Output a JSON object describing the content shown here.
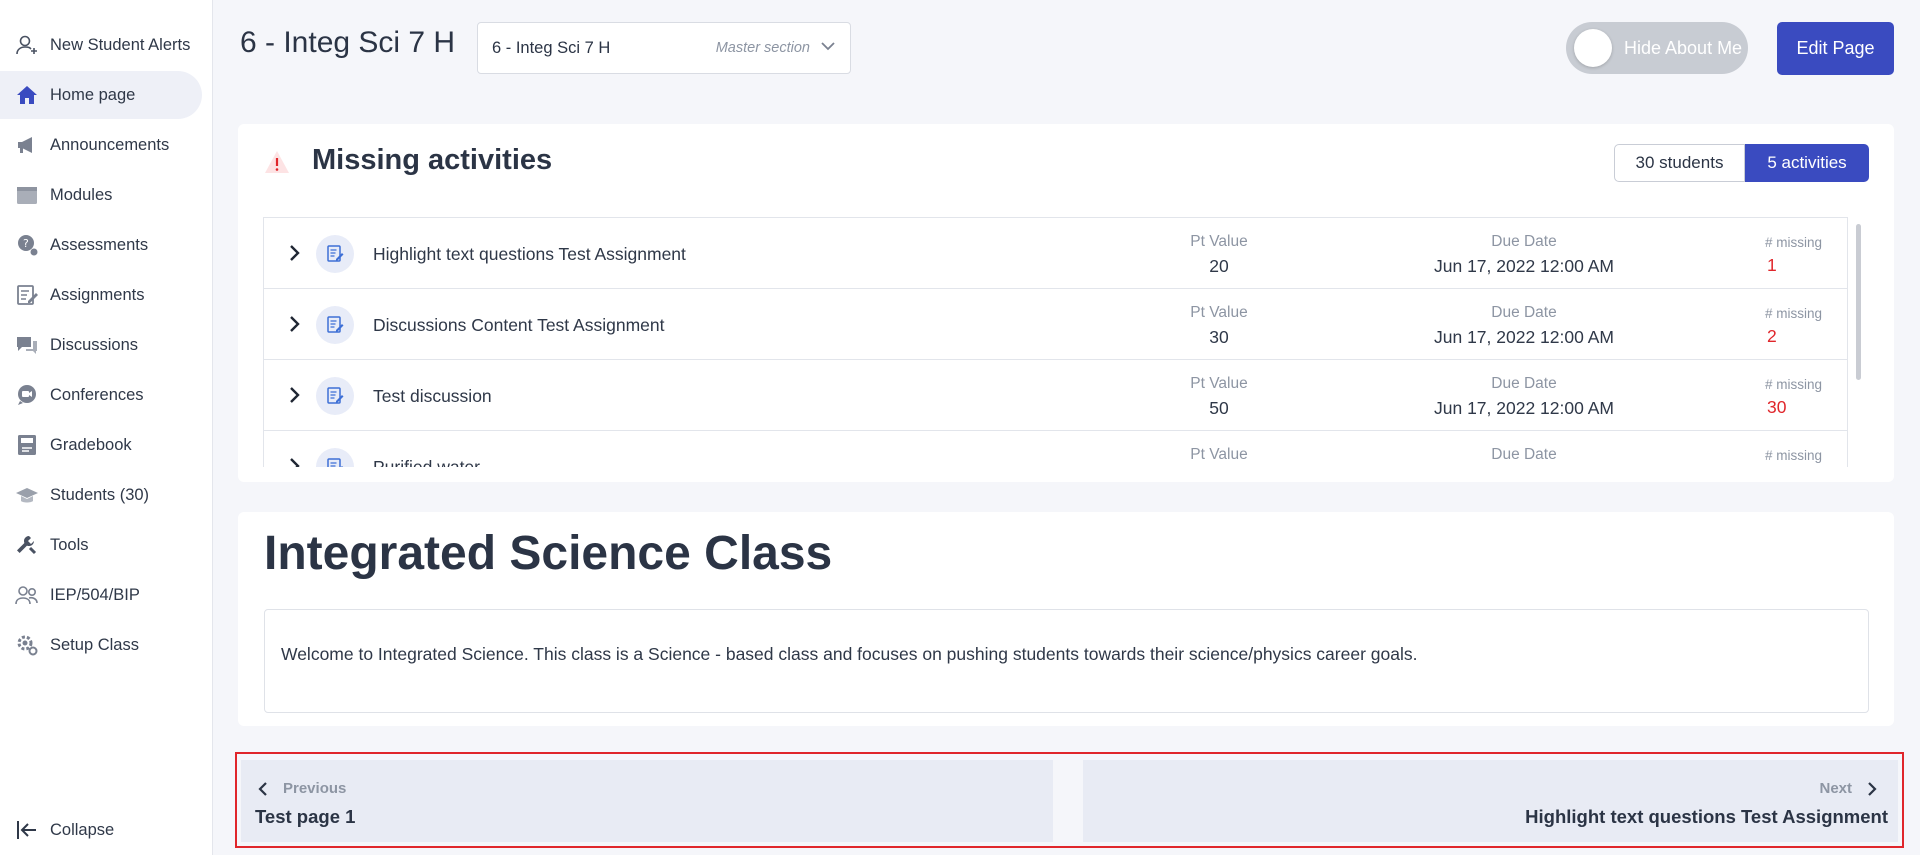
{
  "sidebar": {
    "items": [
      {
        "label": "New Student Alerts",
        "icon": "user-add-icon"
      },
      {
        "label": "Home page",
        "icon": "home-icon"
      },
      {
        "label": "Announcements",
        "icon": "megaphone-icon"
      },
      {
        "label": "Modules",
        "icon": "module-icon"
      },
      {
        "label": "Assessments",
        "icon": "assessment-icon"
      },
      {
        "label": "Assignments",
        "icon": "assignment-icon"
      },
      {
        "label": "Discussions",
        "icon": "discussion-icon"
      },
      {
        "label": "Conferences",
        "icon": "conference-icon"
      },
      {
        "label": "Gradebook",
        "icon": "gradebook-icon"
      },
      {
        "label": "Students (30)",
        "icon": "students-icon"
      },
      {
        "label": "Tools",
        "icon": "tools-icon"
      },
      {
        "label": "IEP/504/BIP",
        "icon": "iep-icon"
      },
      {
        "label": "Setup Class",
        "icon": "gear-icon"
      }
    ],
    "active_index": 1,
    "collapse_label": "Collapse"
  },
  "header": {
    "title": "6 - Integ Sci 7 H",
    "section_select": {
      "value": "6 - Integ Sci 7 H",
      "hint": "Master section"
    },
    "toggle_label": "Hide About Me",
    "toggle_on": false,
    "edit_button": "Edit Page"
  },
  "missing": {
    "title": "Missing activities",
    "segment_students": "30 students",
    "segment_activities": "5 activities",
    "active_segment": "activities",
    "pt_label": "Pt Value",
    "due_label": "Due Date",
    "missing_label": "# missing",
    "rows": [
      {
        "name": "Highlight text questions Test Assignment",
        "pt": "20",
        "due": "Jun 17, 2022 12:00 AM",
        "missing": "1"
      },
      {
        "name": "Discussions Content Test Assignment",
        "pt": "30",
        "due": "Jun 17, 2022 12:00 AM",
        "missing": "2"
      },
      {
        "name": "Test discussion",
        "pt": "50",
        "due": "Jun 17, 2022 12:00 AM",
        "missing": "30"
      },
      {
        "name": "Purified water",
        "pt": "",
        "due": "",
        "missing": ""
      }
    ]
  },
  "content": {
    "title": "Integrated Science Class",
    "body": "Welcome to Integrated Science. This class is a Science - based  class and focuses on pushing students towards their science/physics career goals."
  },
  "pager": {
    "previous_label": "Previous",
    "previous_title": "Test page 1",
    "next_label": "Next",
    "next_title": "Highlight text questions Test Assignment"
  },
  "colors": {
    "accent": "#3a4bc0",
    "missing_red": "#e0262b",
    "highlight_frame": "#e0262b"
  }
}
